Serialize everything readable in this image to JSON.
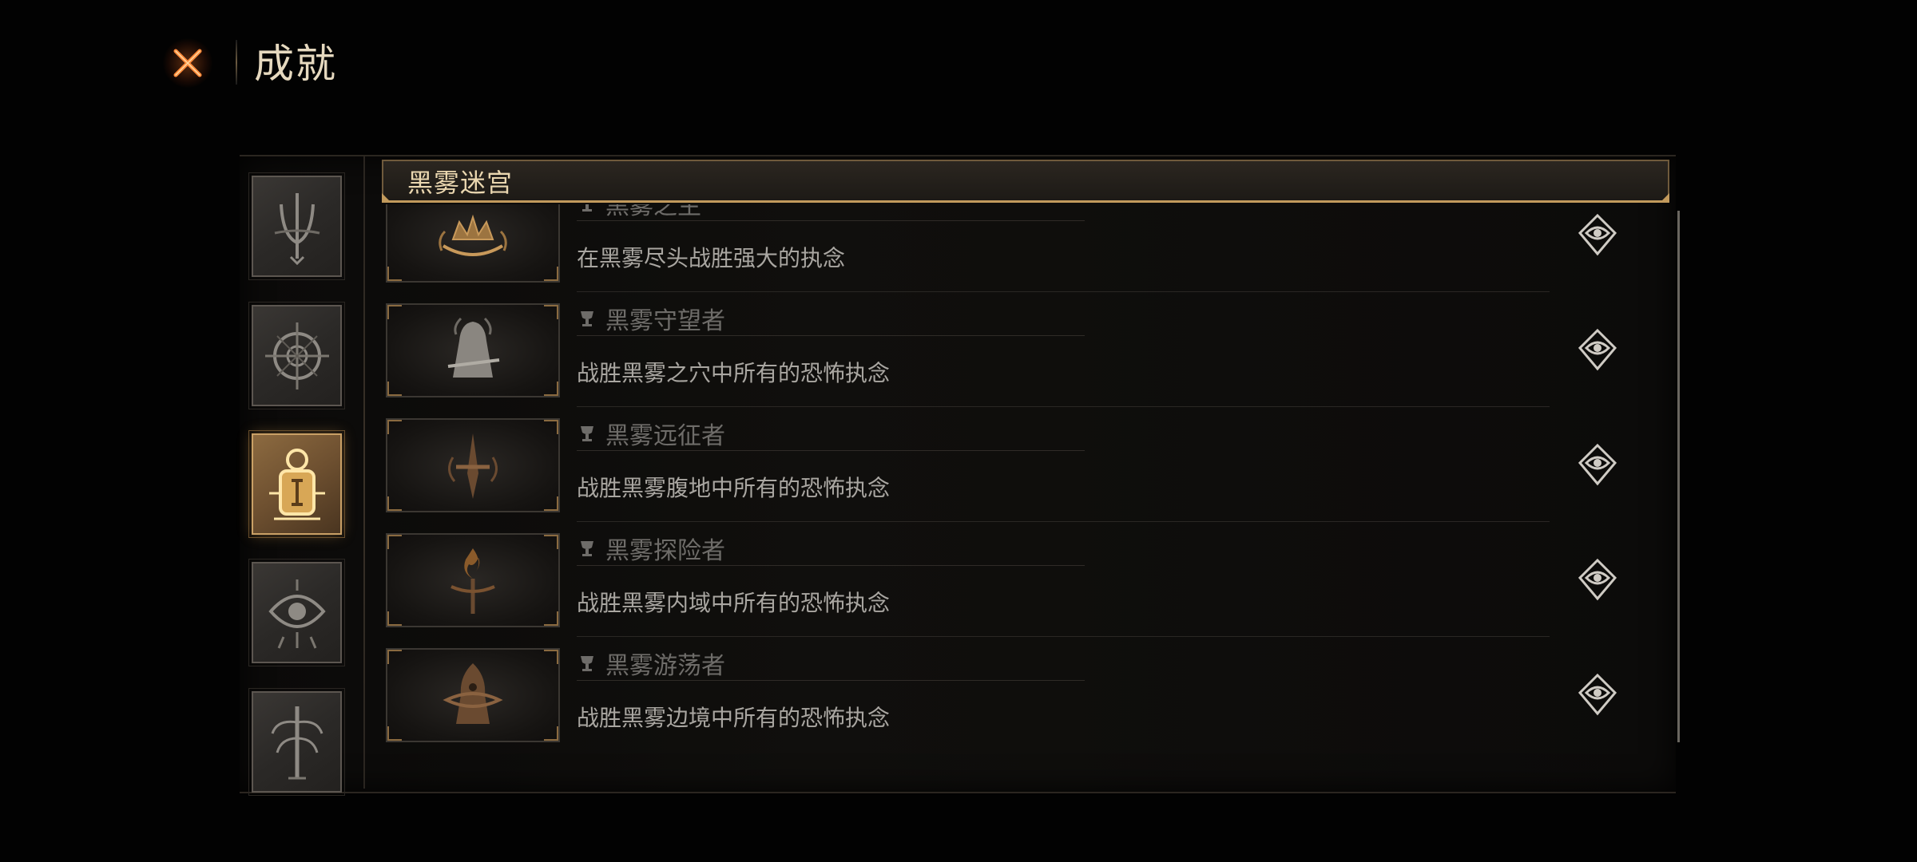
{
  "header": {
    "title": "成就",
    "close_icon": "close-x-icon"
  },
  "colors": {
    "accent_gold": "#c29a5c",
    "active_tab": "#8c6a40",
    "close_orange": "#ff7a2a"
  },
  "categories": [
    {
      "icon": "trident-emblem-icon",
      "active": false
    },
    {
      "icon": "compass-sigil-icon",
      "active": false
    },
    {
      "icon": "lantern-sigil-icon",
      "active": true
    },
    {
      "icon": "eye-sigil-icon",
      "active": false
    },
    {
      "icon": "tree-sigil-icon",
      "active": false
    }
  ],
  "section": {
    "title": "黑雾迷宫"
  },
  "achievements": [
    {
      "title": "黑雾之主",
      "desc": "在黑雾尽头战胜强大的执念",
      "icon": "crown-claw-icon",
      "trophy_icon": "trophy-icon",
      "reward_icon": "eye-diamond-icon"
    },
    {
      "title": "黑雾守望者",
      "desc": "战胜黑雾之穴中所有的恐怖执念",
      "icon": "hooded-figure-icon",
      "trophy_icon": "trophy-icon",
      "reward_icon": "eye-diamond-icon"
    },
    {
      "title": "黑雾远征者",
      "desc": "战胜黑雾腹地中所有的恐怖执念",
      "icon": "sword-emblem-icon",
      "trophy_icon": "trophy-icon",
      "reward_icon": "eye-diamond-icon"
    },
    {
      "title": "黑雾探险者",
      "desc": "战胜黑雾内域中所有的恐怖执念",
      "icon": "torch-flame-icon",
      "trophy_icon": "trophy-icon",
      "reward_icon": "eye-diamond-icon"
    },
    {
      "title": "黑雾游荡者",
      "desc": "战胜黑雾边境中所有的恐怖执念",
      "icon": "cloaked-wanderer-icon",
      "trophy_icon": "trophy-icon",
      "reward_icon": "eye-diamond-icon"
    }
  ]
}
